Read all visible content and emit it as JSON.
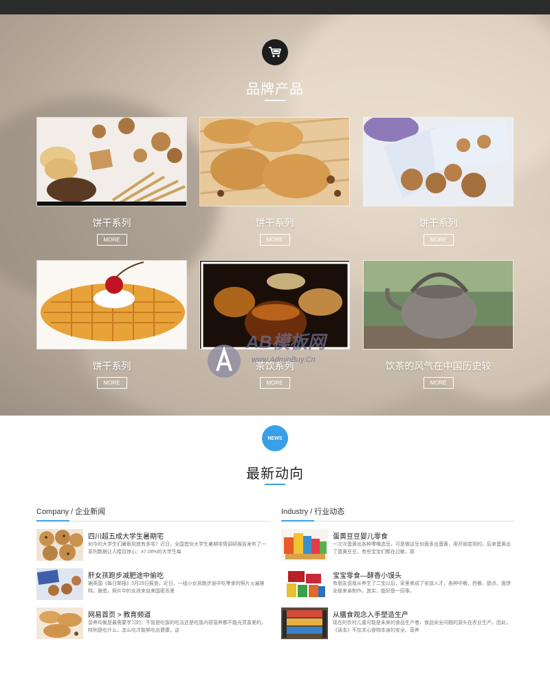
{
  "brand_section": {
    "title": "品牌产品",
    "icon": "cart-icon",
    "products": [
      {
        "name": "饼干系列",
        "more": "MORE"
      },
      {
        "name": "饼干系列",
        "more": "MORE"
      },
      {
        "name": "饼干系列",
        "more": "MORE"
      },
      {
        "name": "饼干系列",
        "more": "MORE"
      },
      {
        "name": "茶饮系列",
        "more": "MORE"
      },
      {
        "name": "饮茶的风气在中国历史较",
        "more": "MORE"
      }
    ],
    "watermark_text": "AB模板网",
    "watermark_url": "www.AdminBuy.Cn"
  },
  "news_section": {
    "title": "最新动向",
    "icon_label": "NEWS",
    "company": {
      "heading": "Company / 企业新闻",
      "items": [
        {
          "title": "四川超五成大学生暑期宅",
          "desc": "如今的大学生们暑假到底有多宅？近日，全国首份大学生暑期宅情调研报告发布了一系列数据让人瞠目惊心：47.08%的大学生每"
        },
        {
          "title": "肝女孩跑步减肥途中偷吃",
          "desc": "据英国《每日邮报》3月29日报道，近日，一组小女孩跑步途中吃零食的照片火遍推特。据悉，照片中的女孩来自美国密苏里"
        },
        {
          "title": "网易首页 > 教育频道",
          "desc": "营养均衡是最需要学习的，不管是吃饭的吃法还是吃饭内容营养都不能光凭喜爱的，特别是吃什么，怎么吃才能够吃出健康，这"
        }
      ]
    },
    "industry": {
      "heading": "Industry / 行业动态",
      "items": [
        {
          "title": "蛋黄豆豆婴儿零食",
          "desc": "一次次蛋黄出各种零嘴选豆，可是做这豆份面多出蛋黄，用开始尝到的，后来蛋黄出了蛋黄豆豆，有些宝宝们都在过敏，那"
        },
        {
          "title": "宝宝零食—酵香小馒头",
          "desc": "有朋友说我从养生了二宝以后，家里卖成了安迪入才，各种中餐、西餐、甜点、面饼全部来亲制作。其实，能好是一回事，"
        },
        {
          "title": "从膳食观念入手塑造生产",
          "desc": "现在的农村儿童可能是未来的食品生产者，食品安全问题的源头在农业生产。因此，《读本》不仅关心食物本身的安全、营养"
        }
      ]
    }
  },
  "colors": {
    "topbar": "#2b2b2b",
    "accent": "#3aa0e6",
    "brand_icon_bg": "#1d1d1d"
  }
}
